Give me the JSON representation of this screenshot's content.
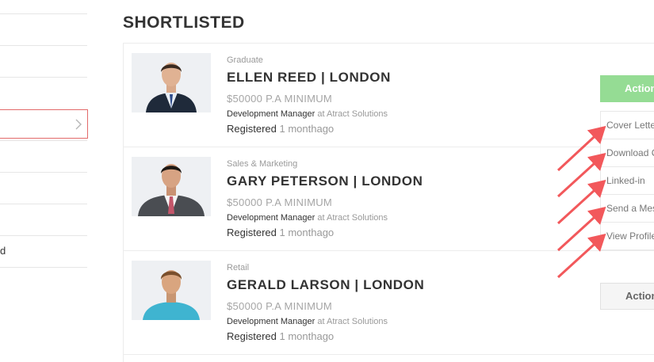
{
  "sidebar": {
    "label_fragment": "d"
  },
  "page": {
    "title": "SHORTLISTED"
  },
  "candidates": [
    {
      "category": "Graduate",
      "name": "ELLEN REED | LONDON",
      "salary": "$50000 P.A MINIMUM",
      "role": "Development Manager",
      "at_company": "at Atract Solutions",
      "registered_label": "Registered",
      "registered_ago": "1 monthago",
      "action_label": "Actions"
    },
    {
      "category": "Sales & Marketing",
      "name": "GARY PETERSON | LONDON",
      "salary": "$50000 P.A MINIMUM",
      "role": "Development Manager",
      "at_company": "at Atract Solutions",
      "registered_label": "Registered",
      "registered_ago": "1 monthago"
    },
    {
      "category": "Retail",
      "name": "GERALD LARSON | LONDON",
      "salary": "$50000 P.A MINIMUM",
      "role": "Development Manager",
      "at_company": "at Atract Solutions",
      "registered_label": "Registered",
      "registered_ago": "1 monthago",
      "action_label": "Actions"
    }
  ],
  "actions_menu": [
    {
      "label": "Cover Letter"
    },
    {
      "label": "Download CV"
    },
    {
      "label": "Linked-in"
    },
    {
      "label": "Send a Message"
    },
    {
      "label": "View Profile"
    }
  ],
  "colors": {
    "action_active": "#95dc94",
    "annotation_arrow": "#f2585b",
    "sidebar_active_border": "#e36a6a"
  },
  "icons": {
    "sidebar_active": "chevron-right-icon"
  }
}
